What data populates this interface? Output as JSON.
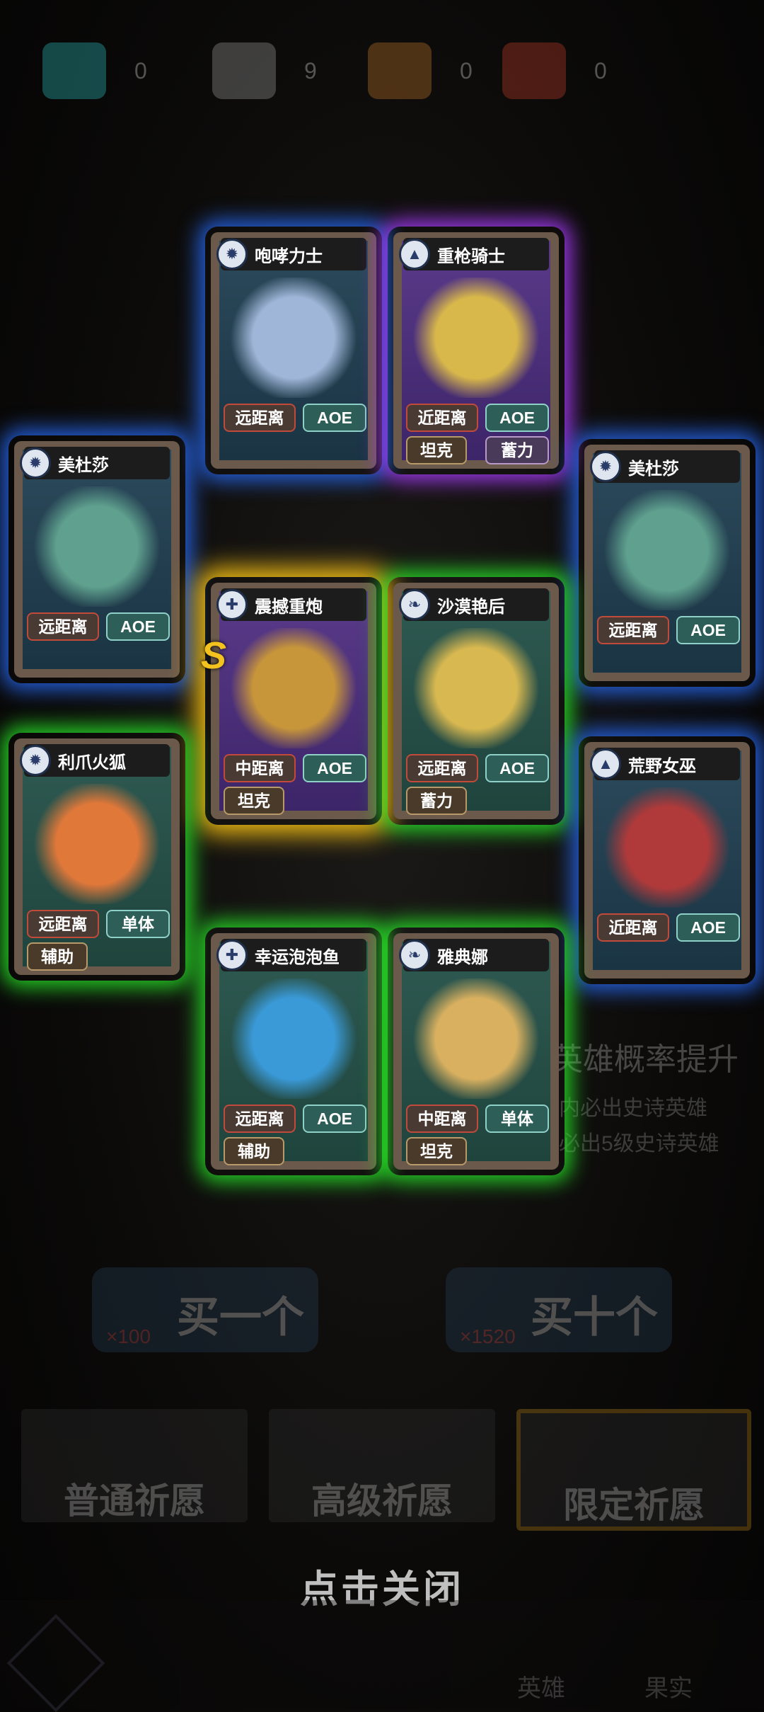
{
  "currency": [
    {
      "icon": "gem-plus-icon",
      "value": "0",
      "color": "#2ec6c6"
    },
    {
      "icon": "wrench-item-icon",
      "value": "9",
      "color": "#a0a0a0"
    },
    {
      "icon": "torch-item-icon",
      "value": "0",
      "color": "#c87a2a"
    },
    {
      "icon": "chest-item-icon",
      "value": "0",
      "color": "#c8402a"
    }
  ],
  "background": {
    "limited_title": "英雄概率提升",
    "line1": "内必出史诗英雄",
    "line2": "必出5级史诗英雄",
    "buy_one": {
      "label": "买一个",
      "cost": "×100"
    },
    "buy_ten": {
      "label": "买十个",
      "cost": "×1520"
    },
    "banners": [
      "普通祈愿",
      "高级祈愿",
      "限定祈愿"
    ]
  },
  "close_hint": "点击关闭",
  "nav": [
    "英雄",
    "果实"
  ],
  "cards": [
    {
      "name": "咆哮力士",
      "range": "远距离",
      "type": "AOE",
      "role": "",
      "role2": "",
      "glow": "blue",
      "theme": "blue",
      "emblem": "✹",
      "art": "#9fb6d8"
    },
    {
      "name": "重枪骑士",
      "range": "近距离",
      "type": "AOE",
      "role": "坦克",
      "role2": "蓄力",
      "glow": "purple",
      "theme": "purple",
      "emblem": "▲",
      "art": "#d8b84a"
    },
    {
      "name": "美杜莎",
      "range": "远距离",
      "type": "AOE",
      "role": "",
      "role2": "",
      "glow": "blue",
      "theme": "blue",
      "emblem": "✹",
      "art": "#5fa08e"
    },
    {
      "name": "美杜莎",
      "range": "远距离",
      "type": "AOE",
      "role": "",
      "role2": "",
      "glow": "blue",
      "theme": "blue",
      "emblem": "✹",
      "art": "#5fa08e"
    },
    {
      "name": "震撼重炮",
      "range": "中距离",
      "type": "AOE",
      "role": "坦克",
      "role2": "",
      "glow": "gold",
      "theme": "purple",
      "emblem": "✚",
      "art": "#c8963a",
      "badge": "S"
    },
    {
      "name": "沙漠艳后",
      "range": "远距离",
      "type": "AOE",
      "role": "蓄力",
      "role2": "",
      "glow": "green",
      "theme": "teal",
      "emblem": "❧",
      "art": "#d8b850"
    },
    {
      "name": "利爪火狐",
      "range": "远距离",
      "type": "单体",
      "role": "辅助",
      "role2": "",
      "glow": "green",
      "theme": "teal",
      "emblem": "✹",
      "art": "#e0783a"
    },
    {
      "name": "荒野女巫",
      "range": "近距离",
      "type": "AOE",
      "role": "",
      "role2": "",
      "glow": "blue",
      "theme": "blue",
      "emblem": "▲",
      "art": "#b03a3a"
    },
    {
      "name": "幸运泡泡鱼",
      "range": "远距离",
      "type": "AOE",
      "role": "辅助",
      "role2": "",
      "glow": "green",
      "theme": "teal",
      "emblem": "✚",
      "art": "#3a9ad8"
    },
    {
      "name": "雅典娜",
      "range": "中距离",
      "type": "单体",
      "role": "坦克",
      "role2": "",
      "glow": "green",
      "theme": "teal",
      "emblem": "❧",
      "art": "#d8b060"
    }
  ]
}
